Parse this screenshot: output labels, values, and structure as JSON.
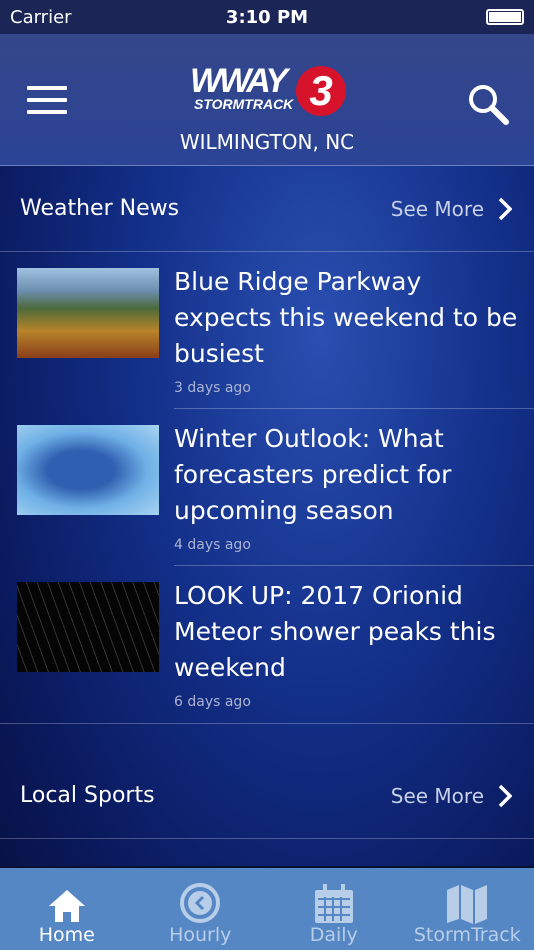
{
  "status": {
    "carrier": "Carrier",
    "time": "3:10 PM"
  },
  "header": {
    "logo_text": "WWAY STORMTRACK 3",
    "city": "WILMINGTON, NC"
  },
  "weather_news": {
    "title": "Weather News",
    "see_more": "See More",
    "items": [
      {
        "headline": "Blue Ridge Parkway expects this weekend to be busiest",
        "age": "3 days ago"
      },
      {
        "headline": "Winter Outlook: What forecasters predict for upcoming season",
        "age": "4 days ago"
      },
      {
        "headline": "LOOK UP: 2017 Orionid Meteor shower peaks this weekend",
        "age": "6 days ago"
      }
    ]
  },
  "local_sports": {
    "title": "Local Sports",
    "see_more": "See More"
  },
  "tabs": [
    {
      "label": "Home",
      "icon": "home-icon",
      "active": true
    },
    {
      "label": "Hourly",
      "icon": "clock-icon"
    },
    {
      "label": "Daily",
      "icon": "calendar-icon"
    },
    {
      "label": "StormTrack",
      "icon": "map-icon"
    }
  ]
}
